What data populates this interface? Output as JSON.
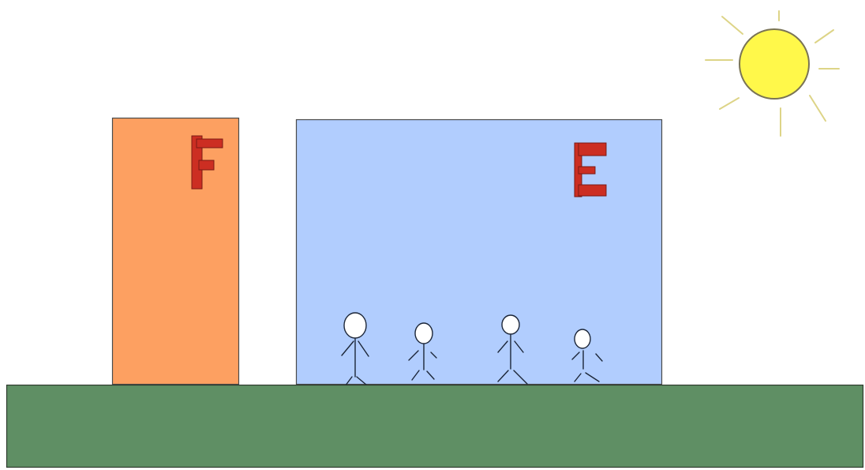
{
  "scene": {
    "background_color": "#ffffff",
    "sun": {
      "fill": "#fff84a",
      "stroke": "#7a7455",
      "ray_color": "#ddd487"
    },
    "ground": {
      "fill": "#5f8f64",
      "stroke": "#2e3b2e"
    },
    "building_f": {
      "letter": "F",
      "fill": "#fda061",
      "stroke": "#4a4a4a"
    },
    "building_e": {
      "letter": "E",
      "fill": "#b1cdfe",
      "stroke": "#4a4a4a"
    },
    "letter_color": "#cc2e22",
    "letter_shadow": "#7a1a14",
    "stick_figures": {
      "count": 4,
      "head_fill": "#ffffff",
      "line_color": "#1c2638"
    }
  }
}
